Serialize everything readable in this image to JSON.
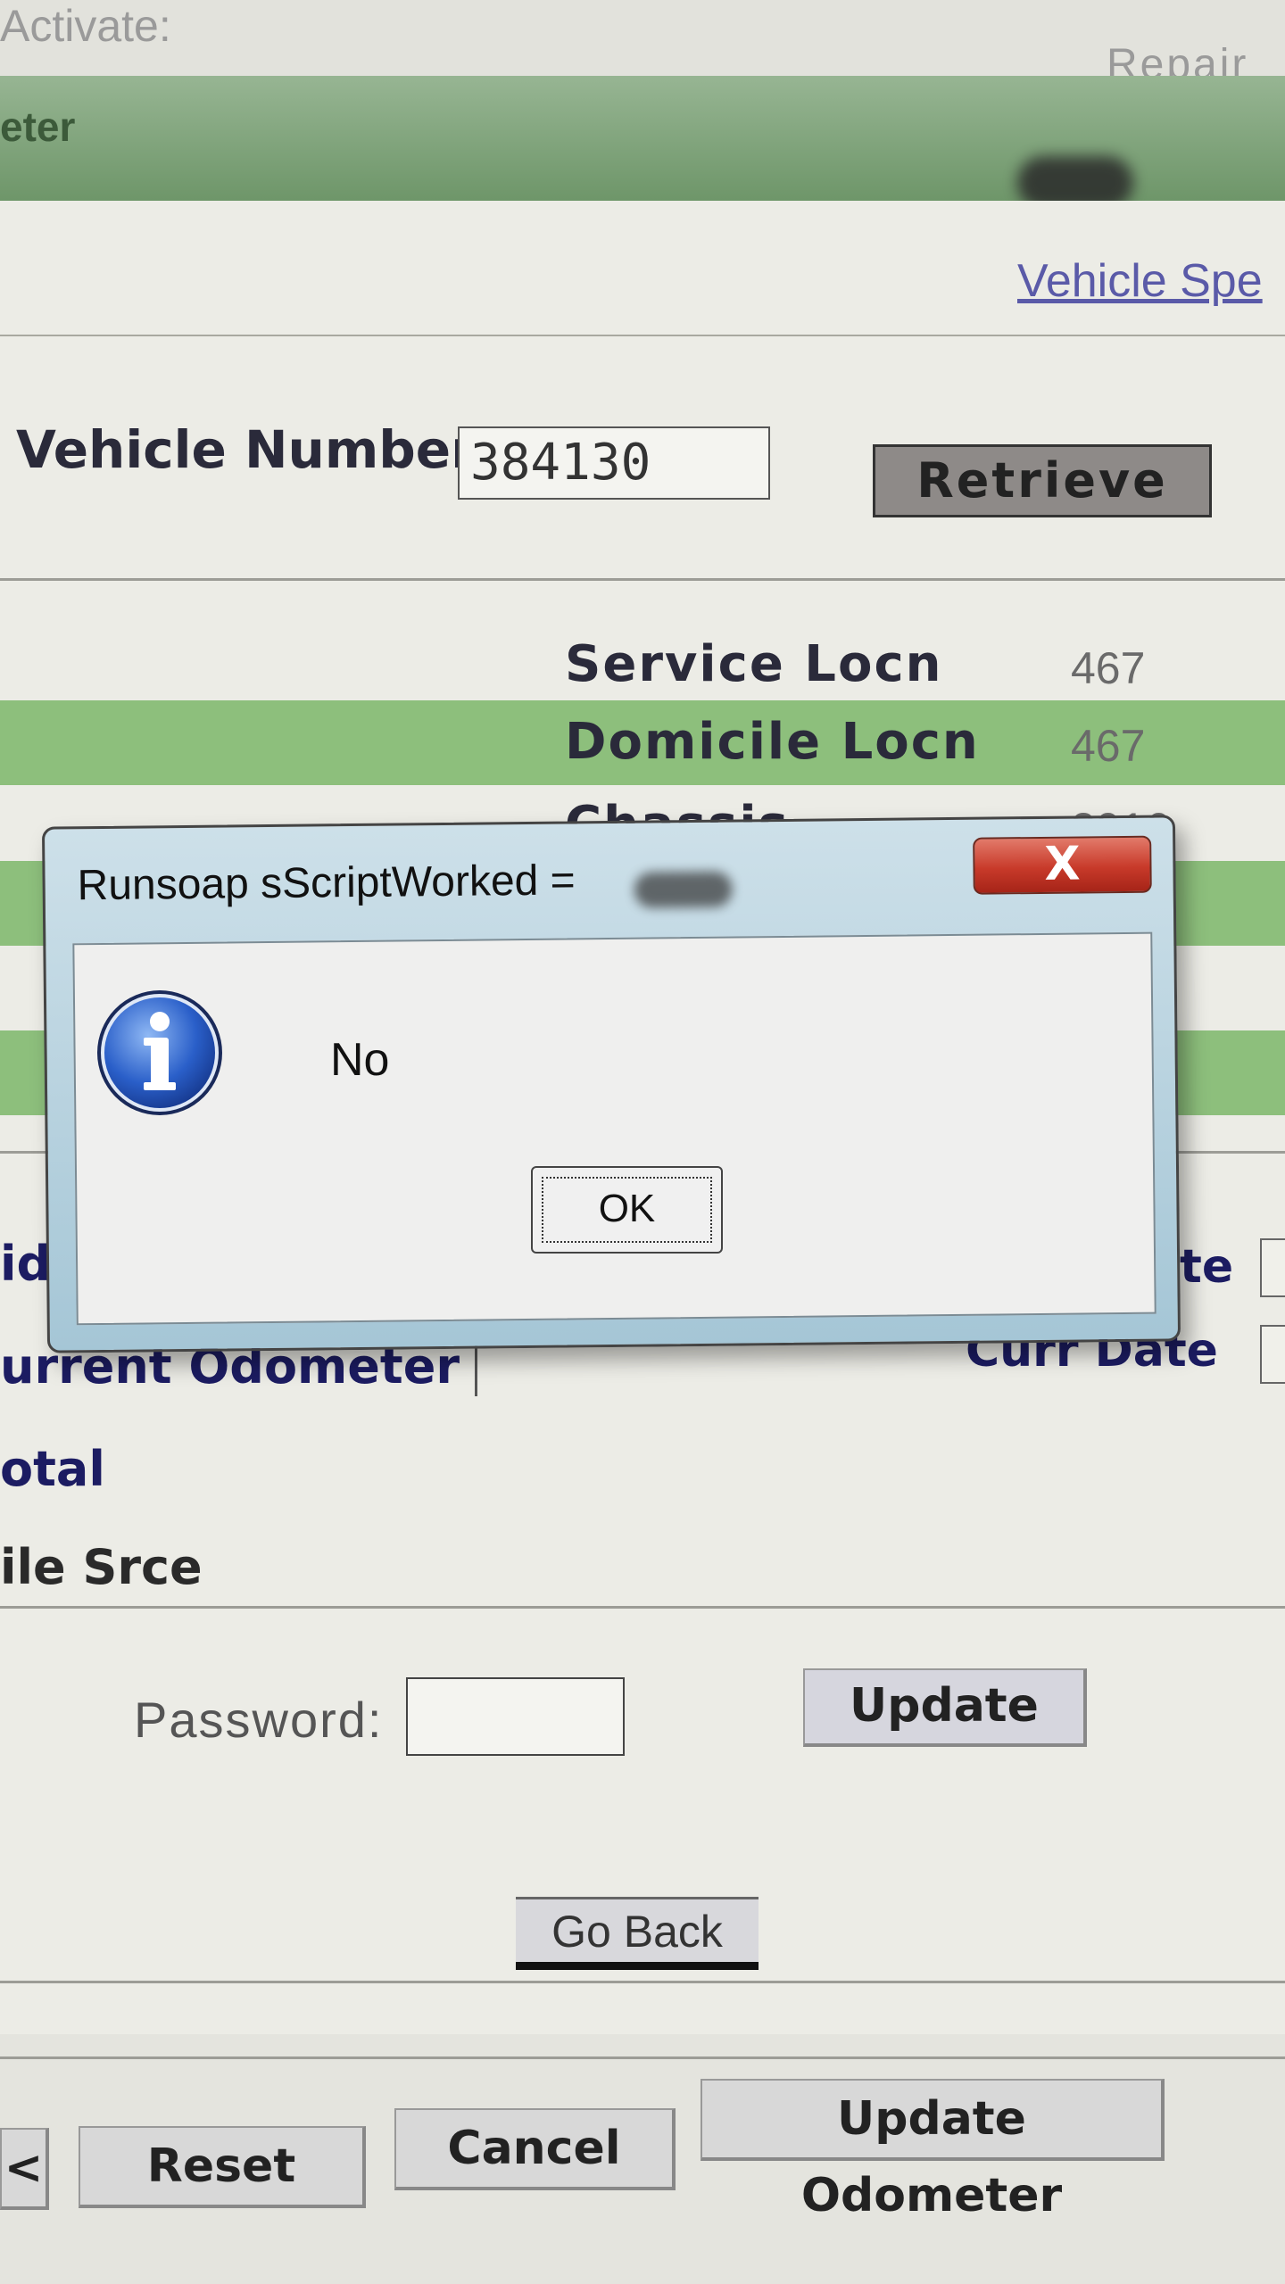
{
  "background": {
    "top_left_text": "Activate:",
    "top_right_text": "Repair",
    "title_fragment": "eter",
    "link_text": "Vehicle Spe",
    "vehicle_label": "Vehicle Number",
    "vehicle_value": "384130",
    "retrieve_label": "Retrieve",
    "rows": [
      {
        "label": "Service Locn",
        "value": "467"
      },
      {
        "label": "Domicile Locn",
        "value": "467"
      },
      {
        "label": "Chassis",
        "value": "2016"
      }
    ],
    "labels": {
      "id_fragment": "id",
      "current_odometer": "urrent Odometer",
      "total_fragment": "otal",
      "file_srce": "ile Srce",
      "curr_date": "Curr Date",
      "date_fragment": "te"
    },
    "password_label": "Password:",
    "update_label": "Update",
    "go_back_label": "Go Back",
    "footer_buttons": {
      "left_fragment": "<",
      "reset": "Reset",
      "cancel": "Cancel",
      "update_odometer": "Update Odometer"
    }
  },
  "dialog": {
    "title": "Runsoap sScriptWorked =",
    "close_symbol": "X",
    "message": "No",
    "ok_label": "OK",
    "icon": "information-icon"
  },
  "colors": {
    "green_row": "#8dbf7c",
    "label_blue": "#1c1c62",
    "close_red": "#c83a2a"
  }
}
